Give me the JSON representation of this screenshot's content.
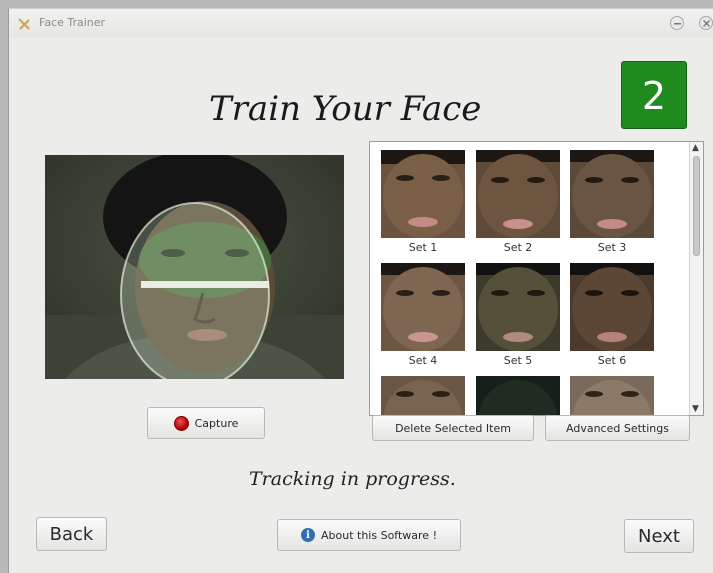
{
  "window": {
    "title": "Face Trainer",
    "icon": "app-logo-icon",
    "controls": {
      "minimize": "minimize-icon",
      "close": "close-icon"
    }
  },
  "heading": "Train Your Face",
  "step": {
    "number": "2",
    "color": "#1f8a1d"
  },
  "camera": {
    "overlay": "face-ellipse-overlay"
  },
  "gallery": {
    "items": [
      {
        "label": "Set 1"
      },
      {
        "label": "Set 2"
      },
      {
        "label": "Set 3"
      },
      {
        "label": "Set 4"
      },
      {
        "label": "Set 5"
      },
      {
        "label": "Set 6"
      },
      {
        "label": ""
      },
      {
        "label": ""
      },
      {
        "label": ""
      }
    ]
  },
  "buttons": {
    "capture": "Capture",
    "delete": "Delete Selected Item",
    "advanced": "Advanced Settings",
    "back": "Back",
    "about": "About this Software !",
    "next": "Next"
  },
  "status": "Tracking in progress."
}
